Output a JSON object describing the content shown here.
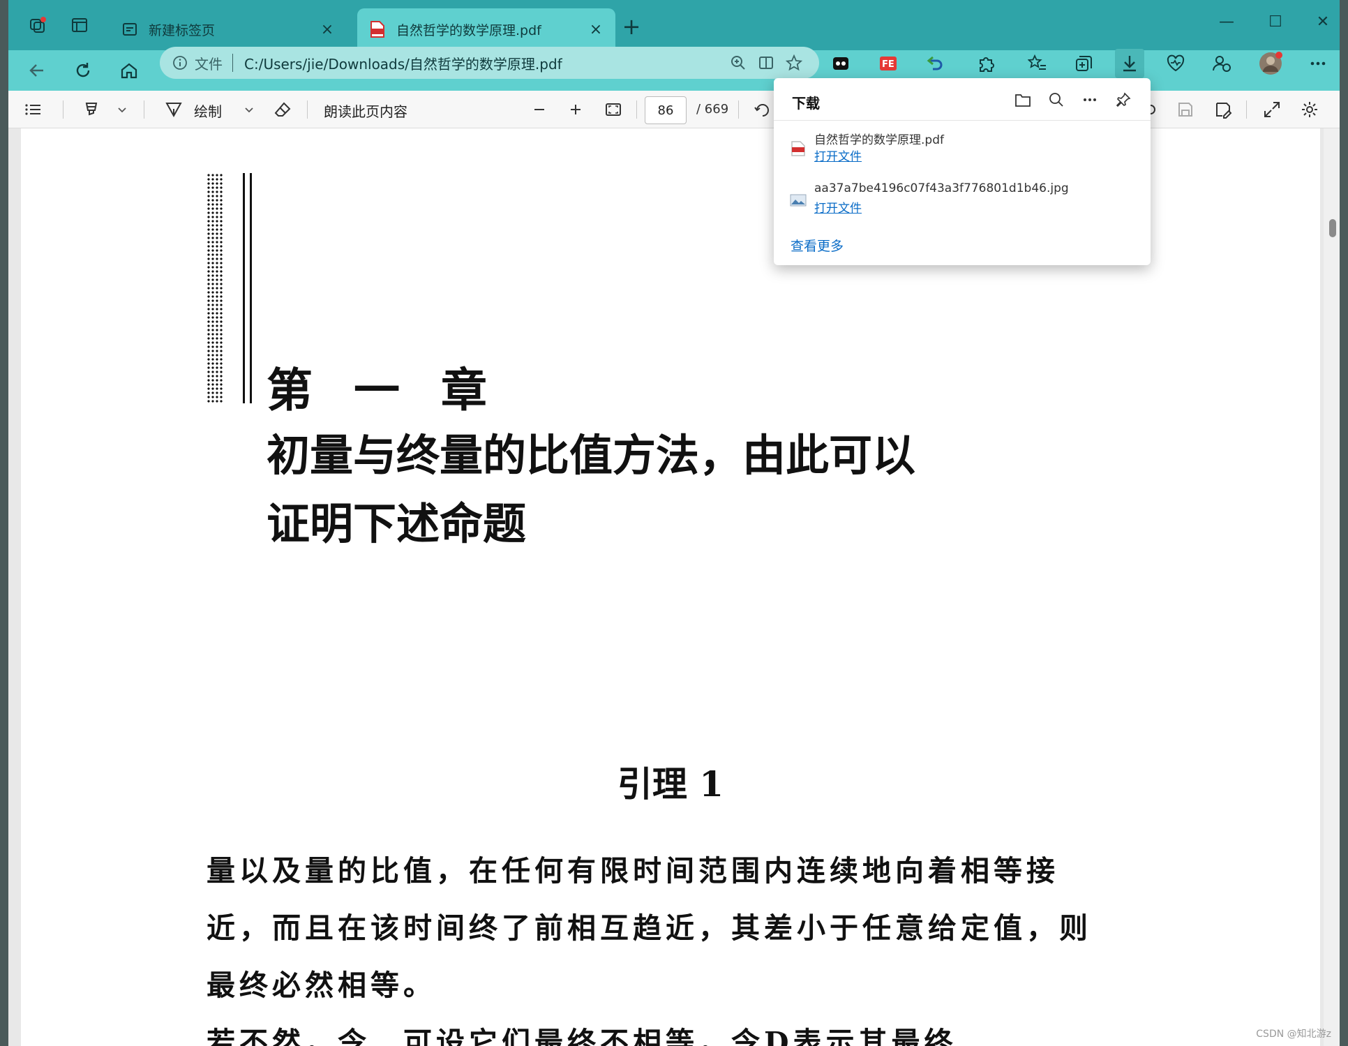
{
  "tabs": [
    {
      "title": "新建标签页",
      "active": false,
      "close": "×"
    },
    {
      "title": "自然哲学的数学原理.pdf",
      "active": true,
      "close": "×"
    }
  ],
  "new_tab": "+",
  "window_controls": {
    "minimize": "—",
    "maximize": "☐",
    "close": "✕"
  },
  "address": {
    "scheme_label": "文件",
    "url": "C:/Users/jie/Downloads/自然哲学的数学原理.pdf"
  },
  "pdf_toolbar": {
    "draw_label": "绘制",
    "read_aloud_label": "朗读此页内容",
    "page_current": "86",
    "page_total": "/ 669"
  },
  "downloads": {
    "title": "下载",
    "items": [
      {
        "name": "自然哲学的数学原理.pdf",
        "action": "打开文件",
        "type": "pdf"
      },
      {
        "name": "aa37a7be4196c07f43a3f776801d1b46.jpg",
        "action": "打开文件",
        "type": "image"
      }
    ],
    "see_more": "查看更多"
  },
  "document": {
    "chapter": "第 一 章",
    "title_lines": [
      "初量与终量的比值方法，由此可以",
      "证明下述命题"
    ],
    "lemma": "引理 1",
    "body_lines": [
      "量以及量的比值，在任何有限时间范围内连续地向着相等接",
      "近，而且在该时间终了前相互趋近，其差小于任意给定值，则",
      "最终必然相等。",
      "若不然，令…可设它们最终不相等，令D表示其最终"
    ]
  },
  "watermark": "CSDN @知北游z",
  "colors": {
    "tabstrip": "#2fa4a8",
    "toolbar": "#5fd0cf",
    "link": "#0a6cc7"
  }
}
